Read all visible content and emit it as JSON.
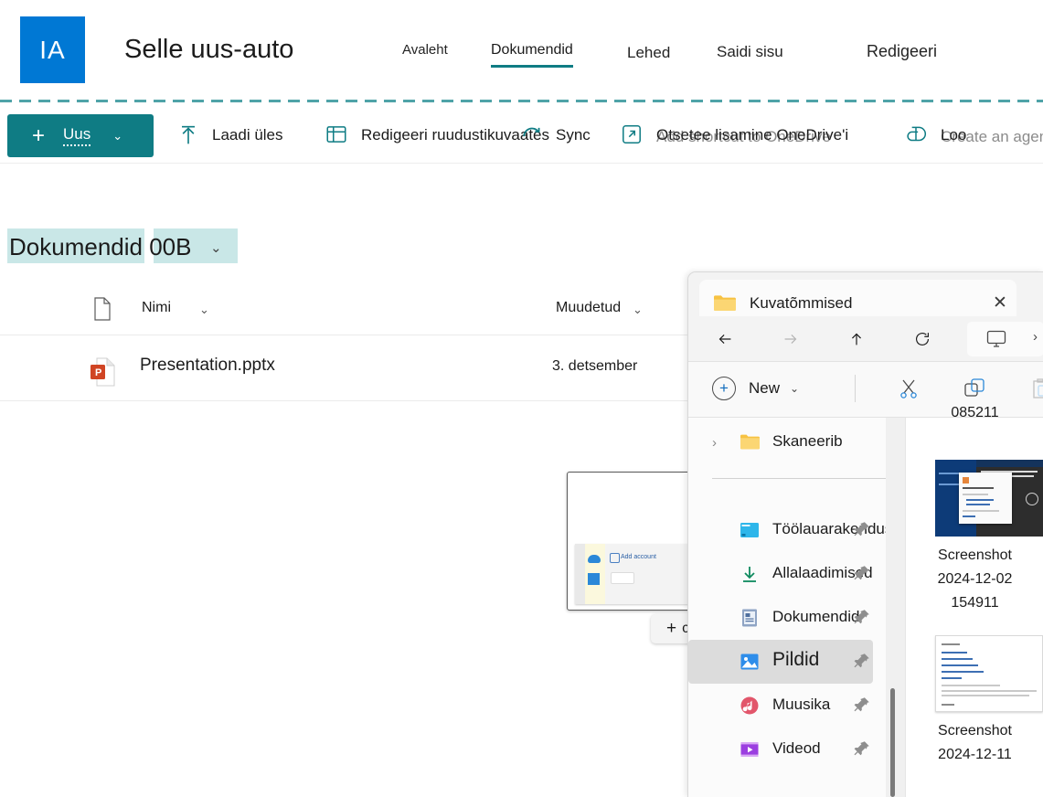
{
  "sharepoint": {
    "logo_text": "IA",
    "site_title": "Selle uus-auto",
    "tabs": [
      {
        "label": "Avaleht",
        "active": false
      },
      {
        "label": "Dokumendid",
        "active": true
      },
      {
        "label": "Lehed",
        "active": false
      },
      {
        "label": "Saidi sisu",
        "active": false
      },
      {
        "label": "Redigeeri",
        "active": false
      }
    ],
    "toolbar": {
      "new_label": "Uus",
      "new_chevron": "⌄",
      "items": [
        {
          "label": "Laadi üles",
          "icon": "upload-icon",
          "ghost": ""
        },
        {
          "label": "Redigeeri ruudustikuvaates",
          "icon": "grid-icon",
          "ghost": ""
        },
        {
          "label": "Sync",
          "icon": "sync-icon",
          "ghost": ""
        },
        {
          "label": "Otsetee lisamine OneDrive'i",
          "icon": "shortcut-icon",
          "ghost": "Add shortcut to OneDrive"
        },
        {
          "label": "Loo",
          "icon": "agent-icon",
          "ghost": "Create an agent"
        }
      ]
    },
    "breadcrumb": {
      "label": "Dokumendid 00B",
      "chevron": "⌄"
    },
    "file_list": {
      "columns": [
        {
          "label": "Nimi",
          "chevron": "⌄"
        },
        {
          "label": "Muudetud",
          "chevron": "⌄"
        }
      ],
      "rows": [
        {
          "name": "Presentation.pptx",
          "modified": "3. detsember",
          "icon": "powerpoint-icon"
        }
      ]
    }
  },
  "drag": {
    "thumbnail_caption": "Add account",
    "drop_label": "copy",
    "drop_plus": "+"
  },
  "explorer": {
    "tab_title": "Kuvatõmmised",
    "close_glyph": "✕",
    "nav": {
      "back": "←",
      "forward": "→",
      "up": "↑",
      "refresh": "↻",
      "address_chevron": "›"
    },
    "command_bar": {
      "new_label": "New",
      "new_plus": "+",
      "new_chevron": "⌄",
      "cut": "cut-icon",
      "copy": "copy-icon",
      "paste": "paste-icon"
    },
    "tree_item": {
      "label": "Skaneerib",
      "expand": "›"
    },
    "quick_access": [
      {
        "label": "Töölauarakendus",
        "icon": "desktop-icon",
        "pinned": true,
        "selected": false
      },
      {
        "label": "Allalaadimised",
        "icon": "downloads-icon",
        "pinned": true,
        "selected": false
      },
      {
        "label": "Dokumendid",
        "icon": "documents-icon",
        "pinned": true,
        "selected": false
      },
      {
        "label": "Pildid",
        "icon": "pictures-icon",
        "pinned": true,
        "selected": true
      },
      {
        "label": "Muusika",
        "icon": "music-icon",
        "pinned": true,
        "selected": false
      },
      {
        "label": "Videod",
        "icon": "videos-icon",
        "pinned": true,
        "selected": false
      }
    ],
    "thumbnails": {
      "partial_top_label": "085211",
      "items": [
        {
          "lines": [
            "Screenshot",
            "2024-12-02",
            "154911"
          ]
        },
        {
          "lines": [
            "Screenshot",
            "2024-12-11"
          ]
        }
      ]
    }
  },
  "colors": {
    "brand_teal": "#0f7c84",
    "logo_blue": "#0078d4",
    "highlight": "#c9e7e7",
    "selection_gray": "#dcdcdc"
  }
}
